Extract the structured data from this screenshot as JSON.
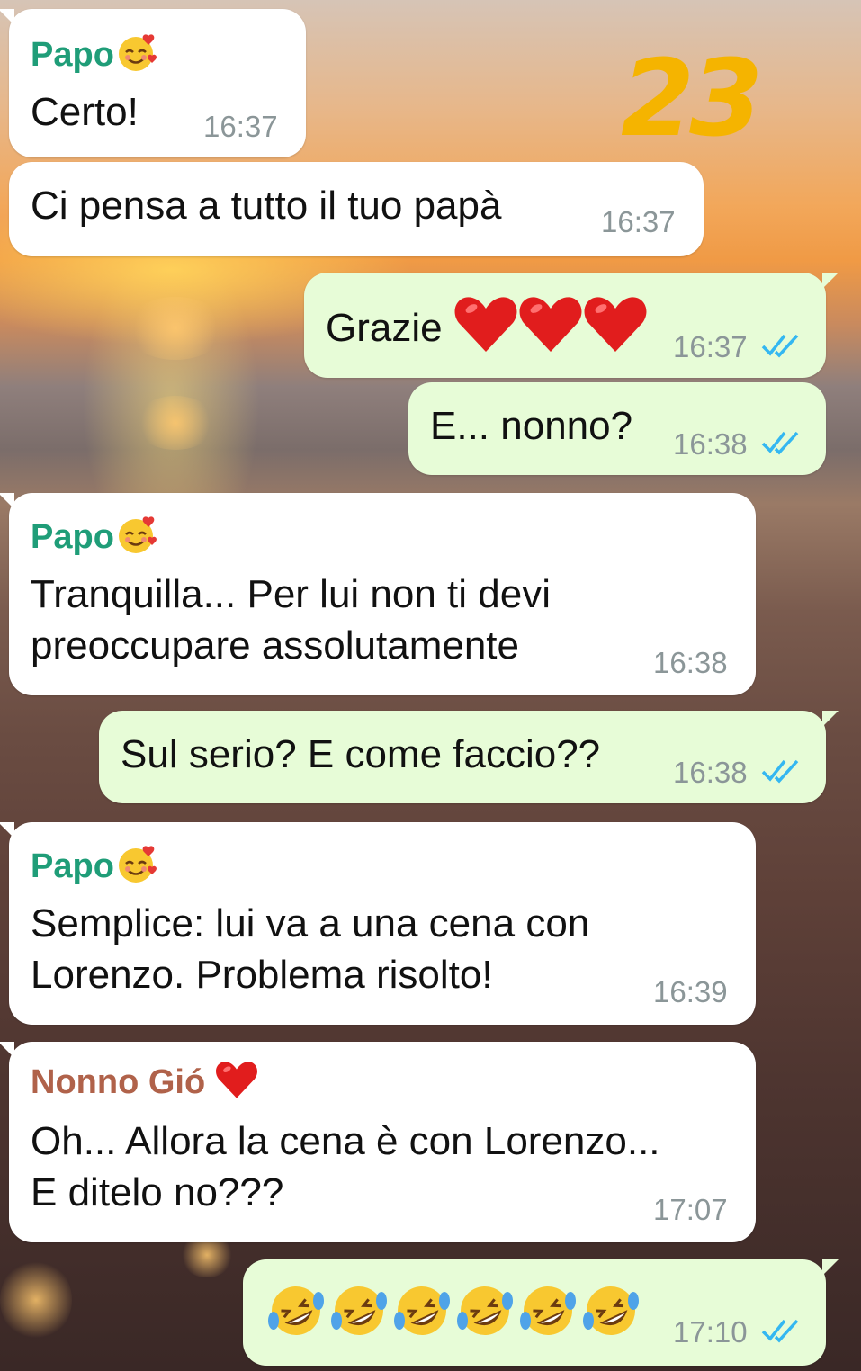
{
  "overlay": {
    "number": "23"
  },
  "colors": {
    "incoming_bubble": "#ffffff",
    "outgoing_bubble": "#e7fcd7",
    "sender_papo": "#1f9d78",
    "sender_nonno": "#b0624a",
    "tick_blue": "#34b7f1",
    "time_gray": "#8b9698",
    "overlay_number": "#f5b400"
  },
  "messages": [
    {
      "dir": "in",
      "sender": "Papo",
      "sender_emoji": "smiling-face-with-hearts-icon",
      "text": "Certo!",
      "time": "16:37"
    },
    {
      "dir": "in",
      "text": "Ci pensa a tutto il tuo papà",
      "time": "16:37"
    },
    {
      "dir": "out",
      "text": "Grazie",
      "emoji": [
        "red-heart-icon",
        "red-heart-icon",
        "red-heart-icon"
      ],
      "time": "16:37",
      "status": "read"
    },
    {
      "dir": "out",
      "text": "E... nonno?",
      "time": "16:38",
      "status": "read"
    },
    {
      "dir": "in",
      "sender": "Papo",
      "sender_emoji": "smiling-face-with-hearts-icon",
      "lines": [
        "Tranquilla... Per lui non ti devi",
        "preoccupare assolutamente"
      ],
      "time": "16:38"
    },
    {
      "dir": "out",
      "text": "Sul serio? E come faccio??",
      "time": "16:38",
      "status": "read"
    },
    {
      "dir": "in",
      "sender": "Papo",
      "sender_emoji": "smiling-face-with-hearts-icon",
      "lines": [
        "Semplice: lui va a una cena con",
        "Lorenzo. Problema risolto!"
      ],
      "time": "16:39"
    },
    {
      "dir": "in",
      "sender": "Nonno Gió",
      "sender_emoji": "red-heart-icon",
      "lines": [
        "Oh... Allora la cena è con Lorenzo...",
        "E ditelo no???"
      ],
      "time": "17:07"
    },
    {
      "dir": "out",
      "emoji": [
        "rolling-on-floor-laughing-icon",
        "rolling-on-floor-laughing-icon",
        "rolling-on-floor-laughing-icon",
        "rolling-on-floor-laughing-icon",
        "rolling-on-floor-laughing-icon",
        "rolling-on-floor-laughing-icon"
      ],
      "time": "17:10",
      "status": "read"
    }
  ]
}
